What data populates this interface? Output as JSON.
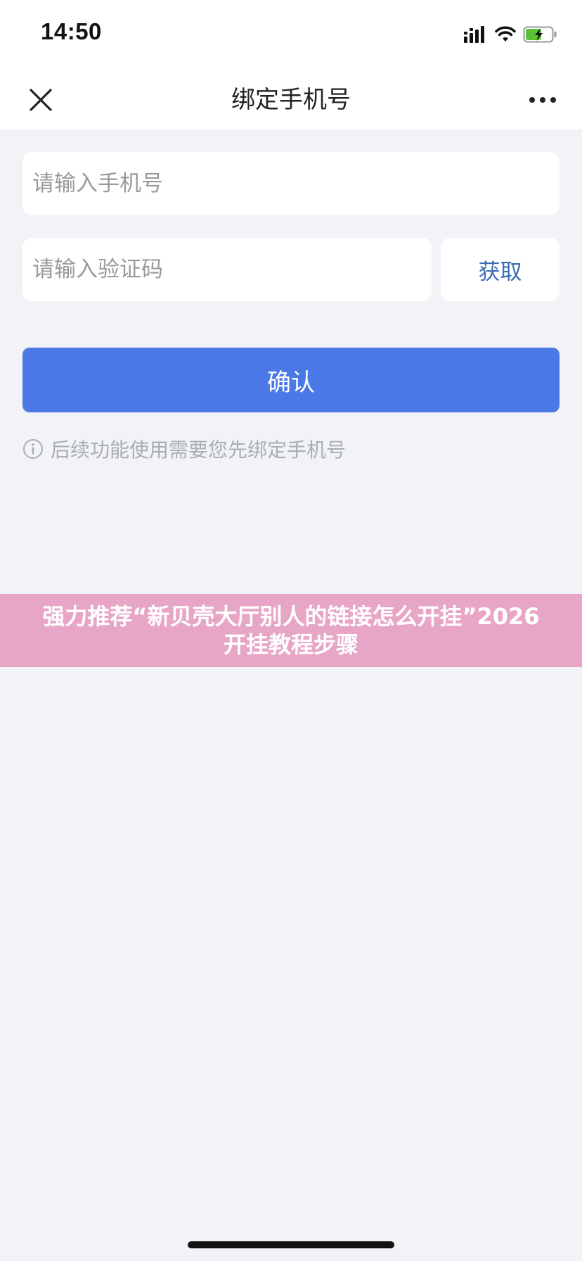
{
  "status_bar": {
    "time": "14:50",
    "icons": [
      "cellular-signal-icon",
      "wifi-icon",
      "battery-charging-icon"
    ]
  },
  "nav": {
    "title": "绑定手机号",
    "close_icon": "close-icon",
    "more_icon": "more-dots-icon"
  },
  "form": {
    "phone": {
      "placeholder": "请输入手机号",
      "value": ""
    },
    "code": {
      "placeholder": "请输入验证码",
      "value": ""
    },
    "get_code_label": "获取",
    "confirm_label": "确认",
    "hint_icon": "info-icon",
    "hint_text": "后续功能使用需要您先绑定手机号"
  },
  "banner": {
    "text": "强力推荐“新贝壳大厅别人的链接怎么开挂”2026开挂教程步骤"
  },
  "colors": {
    "primary": "#4a78e6",
    "link": "#3d6ab5",
    "background": "#f2f3f6",
    "banner": "#e8a6c6",
    "battery": "#5bc236"
  }
}
